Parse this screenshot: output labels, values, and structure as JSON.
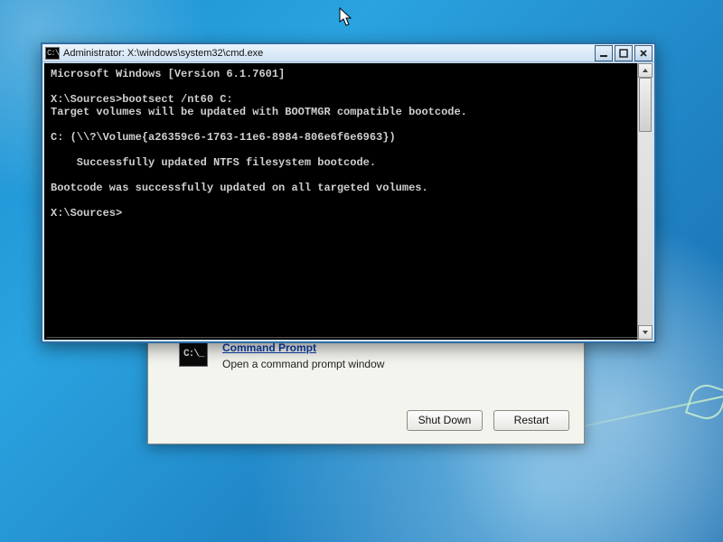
{
  "cmd": {
    "title": "Administrator: X:\\windows\\system32\\cmd.exe",
    "lines": [
      "Microsoft Windows [Version 6.1.7601]",
      "",
      "X:\\Sources>bootsect /nt60 C:",
      "Target volumes will be updated with BOOTMGR compatible bootcode.",
      "",
      "C: (\\\\?\\Volume{a26359c6-1763-11e6-8984-806e6f6e6963})",
      "",
      "    Successfully updated NTFS filesystem bootcode.",
      "",
      "Bootcode was successfully updated on all targeted volumes.",
      "",
      "X:\\Sources>"
    ],
    "icon_text": "C:\\_"
  },
  "recovery": {
    "icon_text": "C:\\_",
    "title": "Command Prompt",
    "subtitle": "Open a command prompt window",
    "buttons": {
      "shutdown": "Shut Down",
      "restart": "Restart"
    }
  }
}
